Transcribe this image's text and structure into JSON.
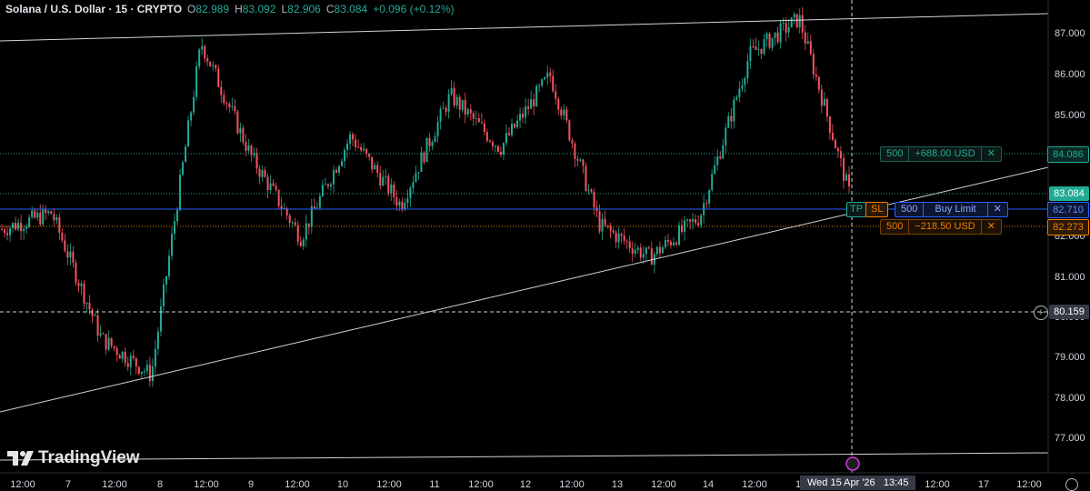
{
  "header": {
    "symbol": "Solana / U.S. Dollar · 15 · CRYPTO",
    "o_label": "O",
    "o_value": "82.989",
    "h_label": "H",
    "h_value": "83.092",
    "l_label": "L",
    "l_value": "82.906",
    "c_label": "C",
    "c_value": "83.084",
    "change": "+0.096 (+0.12%)"
  },
  "price_axis": {
    "ticks": [
      "87.000",
      "86.000",
      "85.000",
      "84.000",
      "83.000",
      "82.000",
      "81.000",
      "80.000",
      "79.000",
      "78.000",
      "77.000"
    ],
    "last_price": "83.084",
    "tp_price": "84.086",
    "buy_limit_price": "82.710",
    "sl_price": "82.273",
    "crosshair_price": "80.159"
  },
  "time_axis": {
    "ticks": [
      "12:00",
      "7",
      "12:00",
      "8",
      "12:00",
      "9",
      "12:00",
      "10",
      "12:00",
      "11",
      "12:00",
      "12",
      "12:00",
      "13",
      "12:00",
      "14",
      "12:00",
      "1",
      "12:00",
      "17",
      "12:00"
    ],
    "crosshair_time": "Wed 15 Apr '26   13:45"
  },
  "orders": {
    "tp_qty": "500",
    "tp_pnl": "+688.00 USD",
    "entry_qty": "500",
    "entry_type": "Buy Limit",
    "sl_qty": "500",
    "sl_pnl": "−218.50 USD",
    "tp_tag": "TP",
    "sl_tag": "SL",
    "close_glyph": "✕"
  },
  "branding": {
    "name": "TradingView"
  },
  "colors": {
    "up": "#22ab94",
    "down": "#f7525f",
    "entry": "#2962ff",
    "sl": "#f57c00",
    "tp": "#22ab94",
    "bg": "#000000"
  },
  "chart_data": {
    "type": "candlestick",
    "series": [
      {
        "name": "Solana / U.S. Dollar",
        "approx_close_path": [
          82.2,
          82.6,
          79.5,
          78.6,
          86.8,
          84.0,
          82.0,
          84.5,
          82.8,
          85.5,
          84.2,
          86.0,
          82.3,
          81.5,
          82.5,
          86.5,
          87.4,
          83.1
        ]
      }
    ],
    "trendlines": [
      {
        "label": "upper"
      },
      {
        "label": "lower"
      }
    ],
    "ylim": [
      76.8,
      87.6
    ]
  }
}
